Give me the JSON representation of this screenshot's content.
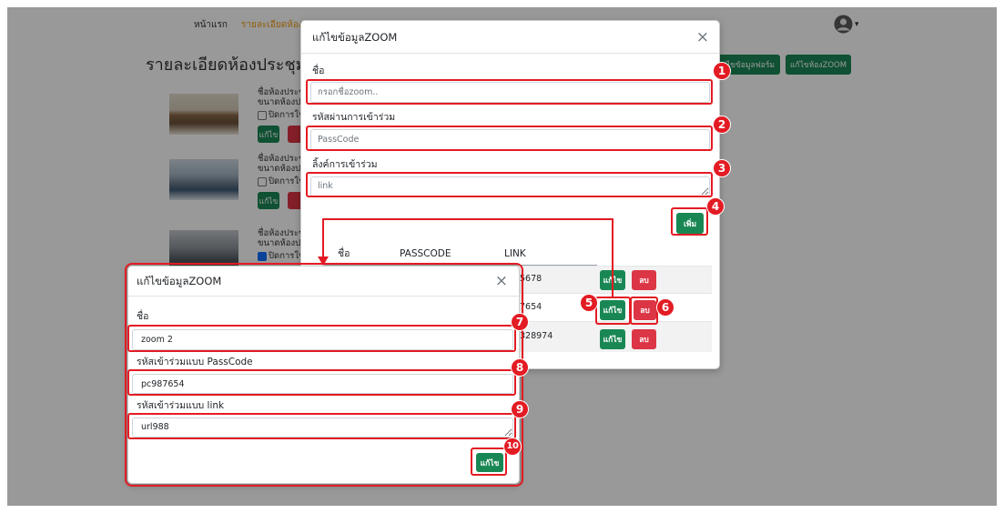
{
  "navbar": {
    "home_label": "หน้าแรก",
    "room_details_label": "รายละเอียดห้องป",
    "caret_symbol": "▾"
  },
  "page": {
    "title": "รายละเอียดห้องประชุม",
    "edit_form_button": "ไขข้อมูลฟอร์ม",
    "edit_zoom_button": "แก้ไขห้องZOOM",
    "rooms": [
      {
        "name_label": "ชื่อห้องประชุ",
        "size_label": "ขนาดห้องปร",
        "disable_label": "ปิดการใช้",
        "checked": false,
        "edit_label": "แก้ไข"
      },
      {
        "name_label": "ชื่อห้องประชุ",
        "size_label": "ขนาดห้องปร",
        "disable_label": "ปิดการใช้",
        "checked": false,
        "edit_label": "แก้ไข"
      },
      {
        "name_label": "ชื่อห้องประชุ",
        "size_label": "ขนาดห้องปร",
        "disable_label": "ปิดการใช้",
        "checked": true
      }
    ]
  },
  "zoom_modal": {
    "title": "แก้ไขข้อมูลZOOM",
    "close_symbol": "×",
    "name_label": "ชื่อ",
    "name_placeholder": "กรอกชื่อzoom..",
    "passcode_label": "รหัสผ่านการเข้าร่วม",
    "passcode_placeholder": "PassCode",
    "link_label": "ลิ้งค์การเข้าร่วม",
    "link_placeholder": "link",
    "add_button": "เพิ่ม",
    "table": {
      "headers": [
        "ชื่อ",
        "PASSCODE",
        "LINK"
      ],
      "rows": [
        {
          "link": "5678",
          "edit": "แก้ไข",
          "delete": "ลบ"
        },
        {
          "link": "7654",
          "edit": "แก้ไข",
          "delete": "ลบ"
        },
        {
          "link": "328974",
          "edit": "แก้ไข",
          "delete": "ลบ"
        }
      ]
    }
  },
  "edit_modal": {
    "title": "แก้ไขข้อมูลZOOM",
    "close_symbol": "×",
    "name_label": "ชื่อ",
    "name_value": "zoom 2",
    "passcode_label": "รหัสเข้าร่วมแบบ PassCode",
    "passcode_value": "pc987654",
    "link_label": "รหัสเข้าร่วมแบบ link",
    "link_value": "url988",
    "submit_button": "แก้ไข"
  },
  "annotations": {
    "markers": [
      "1",
      "2",
      "3",
      "4",
      "5",
      "6",
      "7",
      "8",
      "9",
      "10"
    ]
  },
  "icons": {
    "avatar": "user-avatar-icon",
    "caret": "chevron-down-icon",
    "close": "close-icon"
  },
  "colors": {
    "primary_green": "#198754",
    "danger_red": "#dc3545",
    "nav_active": "#f39c12",
    "annotation_red": "#e31b23"
  }
}
